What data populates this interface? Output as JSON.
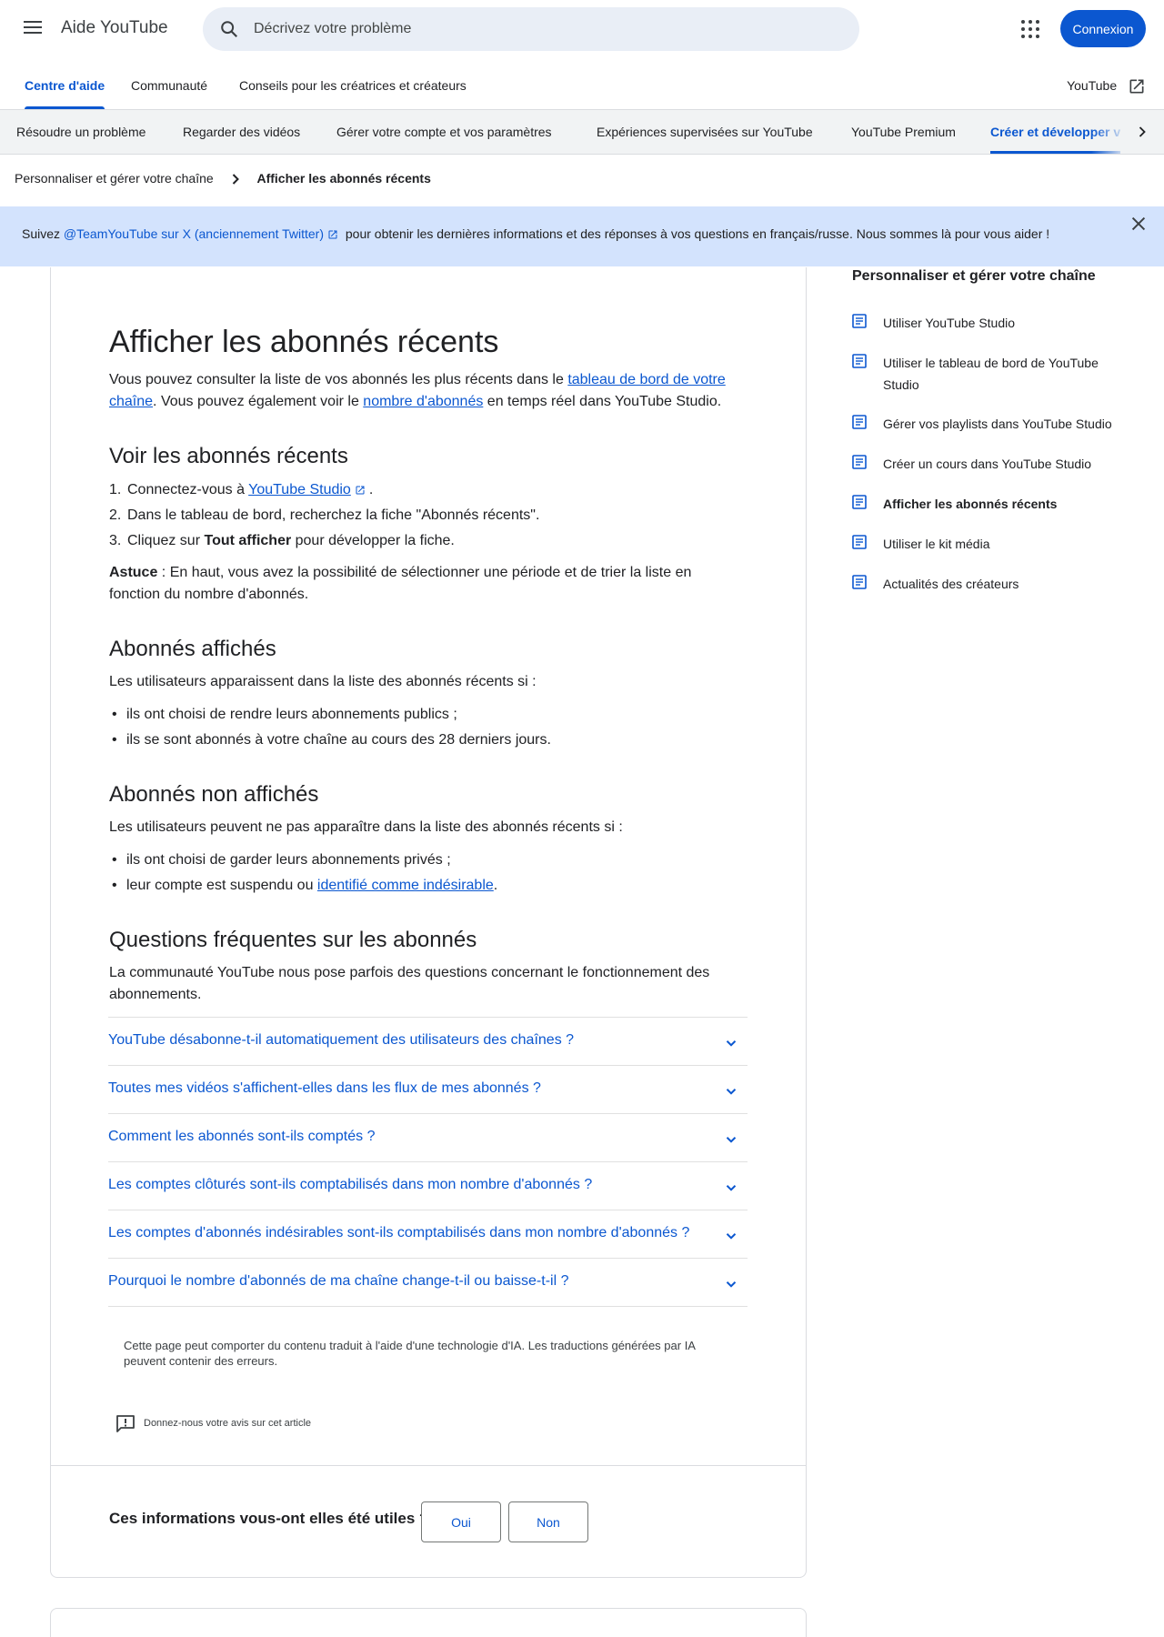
{
  "header": {
    "app_title": "Aide YouTube",
    "search_placeholder": "Décrivez votre problème",
    "signin_label": "Connexion"
  },
  "tabs": [
    {
      "label": "Centre d'aide",
      "active": true
    },
    {
      "label": "Communauté",
      "active": false
    },
    {
      "label": "Conseils pour les créatrices et créateurs",
      "active": false
    }
  ],
  "youtube_link": "YouTube",
  "subtabs": [
    {
      "label": "Résoudre un problème"
    },
    {
      "label": "Regarder des vidéos"
    },
    {
      "label": "Gérer votre compte et vos paramètres"
    },
    {
      "label": "Expériences supervisées sur YouTube"
    },
    {
      "label": "YouTube Premium"
    },
    {
      "label": "Créer et développer v",
      "active": true
    }
  ],
  "breadcrumb": {
    "parent": "Personnaliser et gérer votre chaîne",
    "current": "Afficher les abonnés récents"
  },
  "banner": {
    "prefix": "Suivez ",
    "link": "@TeamYouTube sur X (anciennement Twitter)",
    "suffix": "pour obtenir les dernières informations et des réponses à vos questions en français/russe. Nous sommes là pour vous aider !"
  },
  "article": {
    "title": "Afficher les abonnés récents",
    "intro": {
      "t1": "Vous pouvez consulter la liste de vos abonnés les plus récents dans le ",
      "link1": "tableau de bord de votre chaîne",
      "t2": ". Vous pouvez également voir le ",
      "link2": "nombre d'abonnés",
      "t3": " en temps réel dans YouTube Studio."
    },
    "section1": {
      "heading": "Voir les abonnés récents",
      "step1_text": "Connectez-vous à ",
      "step1_link": "YouTube Studio",
      "step1_end": ".",
      "step2": "Dans le tableau de bord, recherchez la fiche \"Abonnés récents\".",
      "step3_pre": "Cliquez sur ",
      "step3_bold": "Tout afficher",
      "step3_post": " pour développer la fiche.",
      "tip_label": "Astuce",
      "tip_text": " : En haut, vous avez la possibilité de sélectionner une période et de trier la liste en fonction du nombre d'abonnés."
    },
    "section2": {
      "heading": "Abonnés affichés",
      "text": "Les utilisateurs apparaissent dans la liste des abonnés récents si :",
      "bullets": [
        "ils ont choisi de rendre leurs abonnements publics ;",
        "ils se sont abonnés à votre chaîne au cours des 28 derniers jours."
      ]
    },
    "section3": {
      "heading": "Abonnés non affichés",
      "text": "Les utilisateurs peuvent ne pas apparaître dans la liste des abonnés récents si :",
      "bullet1": "ils ont choisi de garder leurs abonnements privés ;",
      "bullet2_pre": "leur compte est suspendu ou ",
      "bullet2_link": "identifié comme indésirable",
      "bullet2_post": "."
    },
    "section4": {
      "heading": "Questions fréquentes sur les abonnés",
      "text": "La communauté YouTube nous pose parfois des questions concernant le fonctionnement des abonnements.",
      "faqs": [
        "YouTube désabonne-t-il automatiquement des utilisateurs des chaînes ?",
        "Toutes mes vidéos s'affichent-elles dans les flux de mes abonnés ?",
        "Comment les abonnés sont-ils comptés ?",
        "Les comptes clôturés sont-ils comptabilisés dans mon nombre d'abonnés ?",
        "Les comptes d'abonnés indésirables sont-ils comptabilisés dans mon nombre d'abonnés ?",
        "Pourquoi le nombre d'abonnés de ma chaîne change-t-il ou baisse-t-il ?"
      ]
    },
    "ai_note": "Cette page peut comporter du contenu traduit à l'aide d'une technologie d'IA. Les traductions générées par IA peuvent contenir des erreurs.",
    "feedback": "Donnez-nous votre avis sur cet article",
    "helpful": {
      "question": "Ces informations vous-ont elles été utiles ?",
      "yes": "Oui",
      "no": "Non"
    }
  },
  "sidebar": {
    "title": "Personnaliser et gérer votre chaîne",
    "items": [
      {
        "label": "Utiliser YouTube Studio"
      },
      {
        "label": "Utiliser le tableau de bord de YouTube Studio"
      },
      {
        "label": "Gérer vos playlists dans YouTube Studio"
      },
      {
        "label": "Créer un cours dans YouTube Studio"
      },
      {
        "label": "Afficher les abonnés récents",
        "current": true
      },
      {
        "label": "Utiliser le kit média"
      },
      {
        "label": "Actualités des créateurs"
      }
    ]
  },
  "colors": {
    "accent": "#0b57d0",
    "banner_bg": "#d3e3fd",
    "search_bg": "#e9eef6"
  }
}
